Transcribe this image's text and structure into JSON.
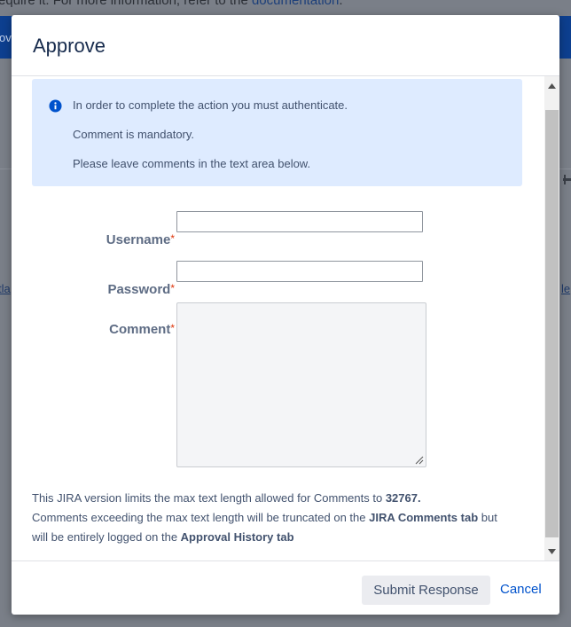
{
  "background": {
    "notice_prefix": "equire it. For more information, refer to the ",
    "notice_link": "documentation",
    "notice_suffix": ".",
    "bar_fragment": "ov",
    "left_fragment": "tla",
    "right_fragment": "le"
  },
  "dialog": {
    "title": "Approve",
    "info": {
      "lines": [
        "In order to complete the action you must authenticate.",
        "Comment is mandatory.",
        "Please leave comments in the text area below."
      ]
    },
    "form": {
      "username_label": "Username",
      "password_label": "Password",
      "comment_label": "Comment",
      "required_marker": "*",
      "username_value": "",
      "password_value": "",
      "comment_value": ""
    },
    "limit": {
      "line1_prefix": "This JIRA version limits the max text length allowed for Comments to ",
      "line1_value": "32767.",
      "line2_prefix": "Comments exceeding the max text length will be truncated on the ",
      "line2_bold": "JIRA Comments tab",
      "line2_suffix": " but",
      "line3_prefix": "will be entirely logged on the ",
      "line3_bold": "Approval History tab"
    },
    "footer": {
      "submit_label": "Submit Response",
      "cancel_label": "Cancel"
    }
  },
  "colors": {
    "accent": "#0052cc",
    "info_background": "#deebff",
    "required": "#de350b",
    "info_icon": "#0052cc"
  },
  "icons": {
    "info": "info-icon",
    "scroll_up": "chevron-up-icon",
    "scroll_down": "chevron-down-icon",
    "resize": "resize-grip-icon"
  }
}
